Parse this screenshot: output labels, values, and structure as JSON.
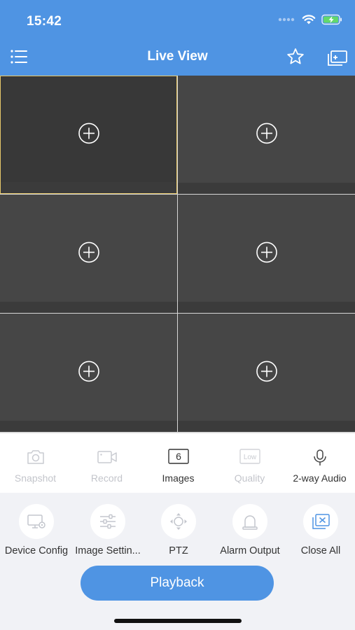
{
  "status_bar": {
    "time": "15:42"
  },
  "nav": {
    "title": "Live View"
  },
  "grid": {
    "tile_count": 6,
    "selected_index": 0
  },
  "toolbar": {
    "items": [
      {
        "label": "Snapshot",
        "icon": "camera-icon",
        "enabled": false
      },
      {
        "label": "Record",
        "icon": "video-record-icon",
        "enabled": false
      },
      {
        "label": "Images",
        "icon": "images-count-icon",
        "badge": "6",
        "enabled": true
      },
      {
        "label": "Quality",
        "icon": "quality-icon",
        "badge": "Low",
        "enabled": false
      },
      {
        "label": "2-way Audio",
        "icon": "microphone-icon",
        "enabled": true
      }
    ]
  },
  "actions": {
    "items": [
      {
        "label": "Device Config",
        "icon": "device-config-icon"
      },
      {
        "label": "Image Settin...",
        "icon": "sliders-icon"
      },
      {
        "label": "PTZ",
        "icon": "ptz-icon"
      },
      {
        "label": "Alarm Output",
        "icon": "alarm-light-icon"
      },
      {
        "label": "Close All",
        "icon": "close-all-icon"
      }
    ],
    "playback_label": "Playback"
  },
  "colors": {
    "primary": "#4f94e3",
    "tile": "#464646",
    "selected_border": "#e8c96a"
  }
}
